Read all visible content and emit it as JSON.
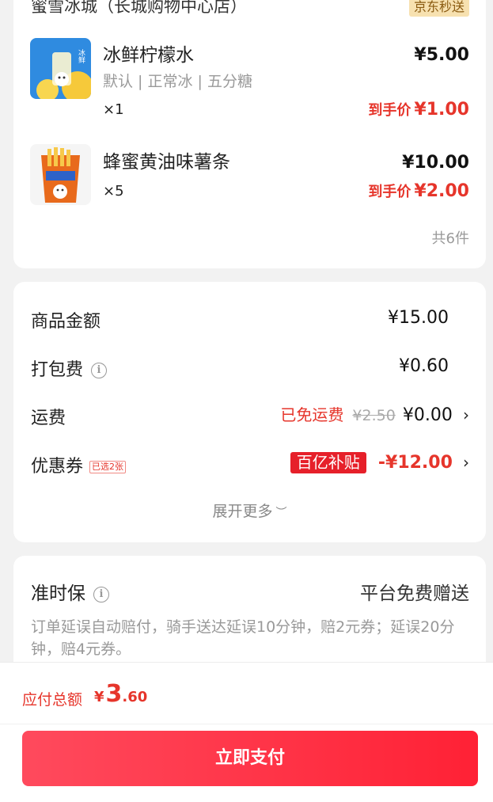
{
  "store": {
    "name": "蜜雪冰城（长城购物中心店）",
    "badge": "京东秒送",
    "items": [
      {
        "name": "冰鲜柠檬水",
        "spec": "默认 | 正常冰 | 五分糖",
        "qty": "×1",
        "price": "¥5.00",
        "final_label": "到手价",
        "final_price": "¥1.00",
        "thumb_text": "冰鲜柠檬"
      },
      {
        "name": "蜂蜜黄油味薯条",
        "qty": "×5",
        "price": "¥10.00",
        "final_label": "到手价",
        "final_price": "¥2.00",
        "thumb_text": "雪王"
      }
    ],
    "total_count": "共6件"
  },
  "fees": {
    "goods_label": "商品金额",
    "goods_value": "¥15.00",
    "packing_label": "打包费",
    "packing_value": "¥0.60",
    "shipping_label": "运费",
    "shipping_free": "已免运费",
    "shipping_original": "¥2.50",
    "shipping_value": "¥0.00",
    "coupon_label": "优惠券",
    "coupon_tag": "已选2张",
    "coupon_badge": "百亿补贴",
    "coupon_value": "-¥12.00",
    "expand": "展开更多"
  },
  "ontime": {
    "label": "准时保",
    "right": "平台免费赠送",
    "desc": "订单延误自动赔付，骑手送达延误10分钟，赔2元券；延误20分钟，赔4元券。"
  },
  "bottom": {
    "total_label": "应付总额",
    "currency": "¥",
    "amount_int": "3",
    "amount_dec": ".60",
    "pay": "立即支付"
  },
  "colors": {
    "accent": "#e6352b",
    "pay_button": "#ff2b3f",
    "badge_bg": "#f7e1b0"
  }
}
